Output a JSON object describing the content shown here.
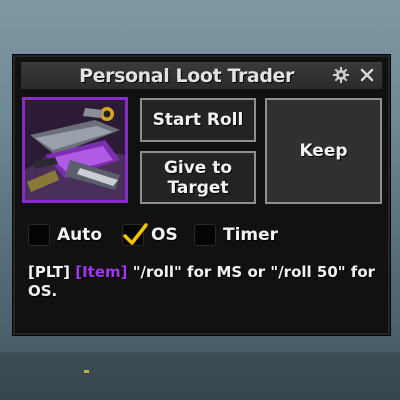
{
  "window": {
    "title": "Personal Loot Trader"
  },
  "icons": {
    "settings": "gear-icon",
    "close": "close-icon",
    "item": "item-icon"
  },
  "item_quality_color": "#a335ee",
  "buttons": {
    "start_roll": "Start Roll",
    "give_to_target": "Give to Target",
    "keep": "Keep"
  },
  "options": [
    {
      "label": "Auto",
      "checked": false
    },
    {
      "label": "OS",
      "checked": true
    },
    {
      "label": "Timer",
      "checked": false
    }
  ],
  "message": {
    "prefix": "[PLT]",
    "item_link": "[Item]",
    "text": " \"/roll\" for MS or \"/roll 50\" for OS."
  }
}
